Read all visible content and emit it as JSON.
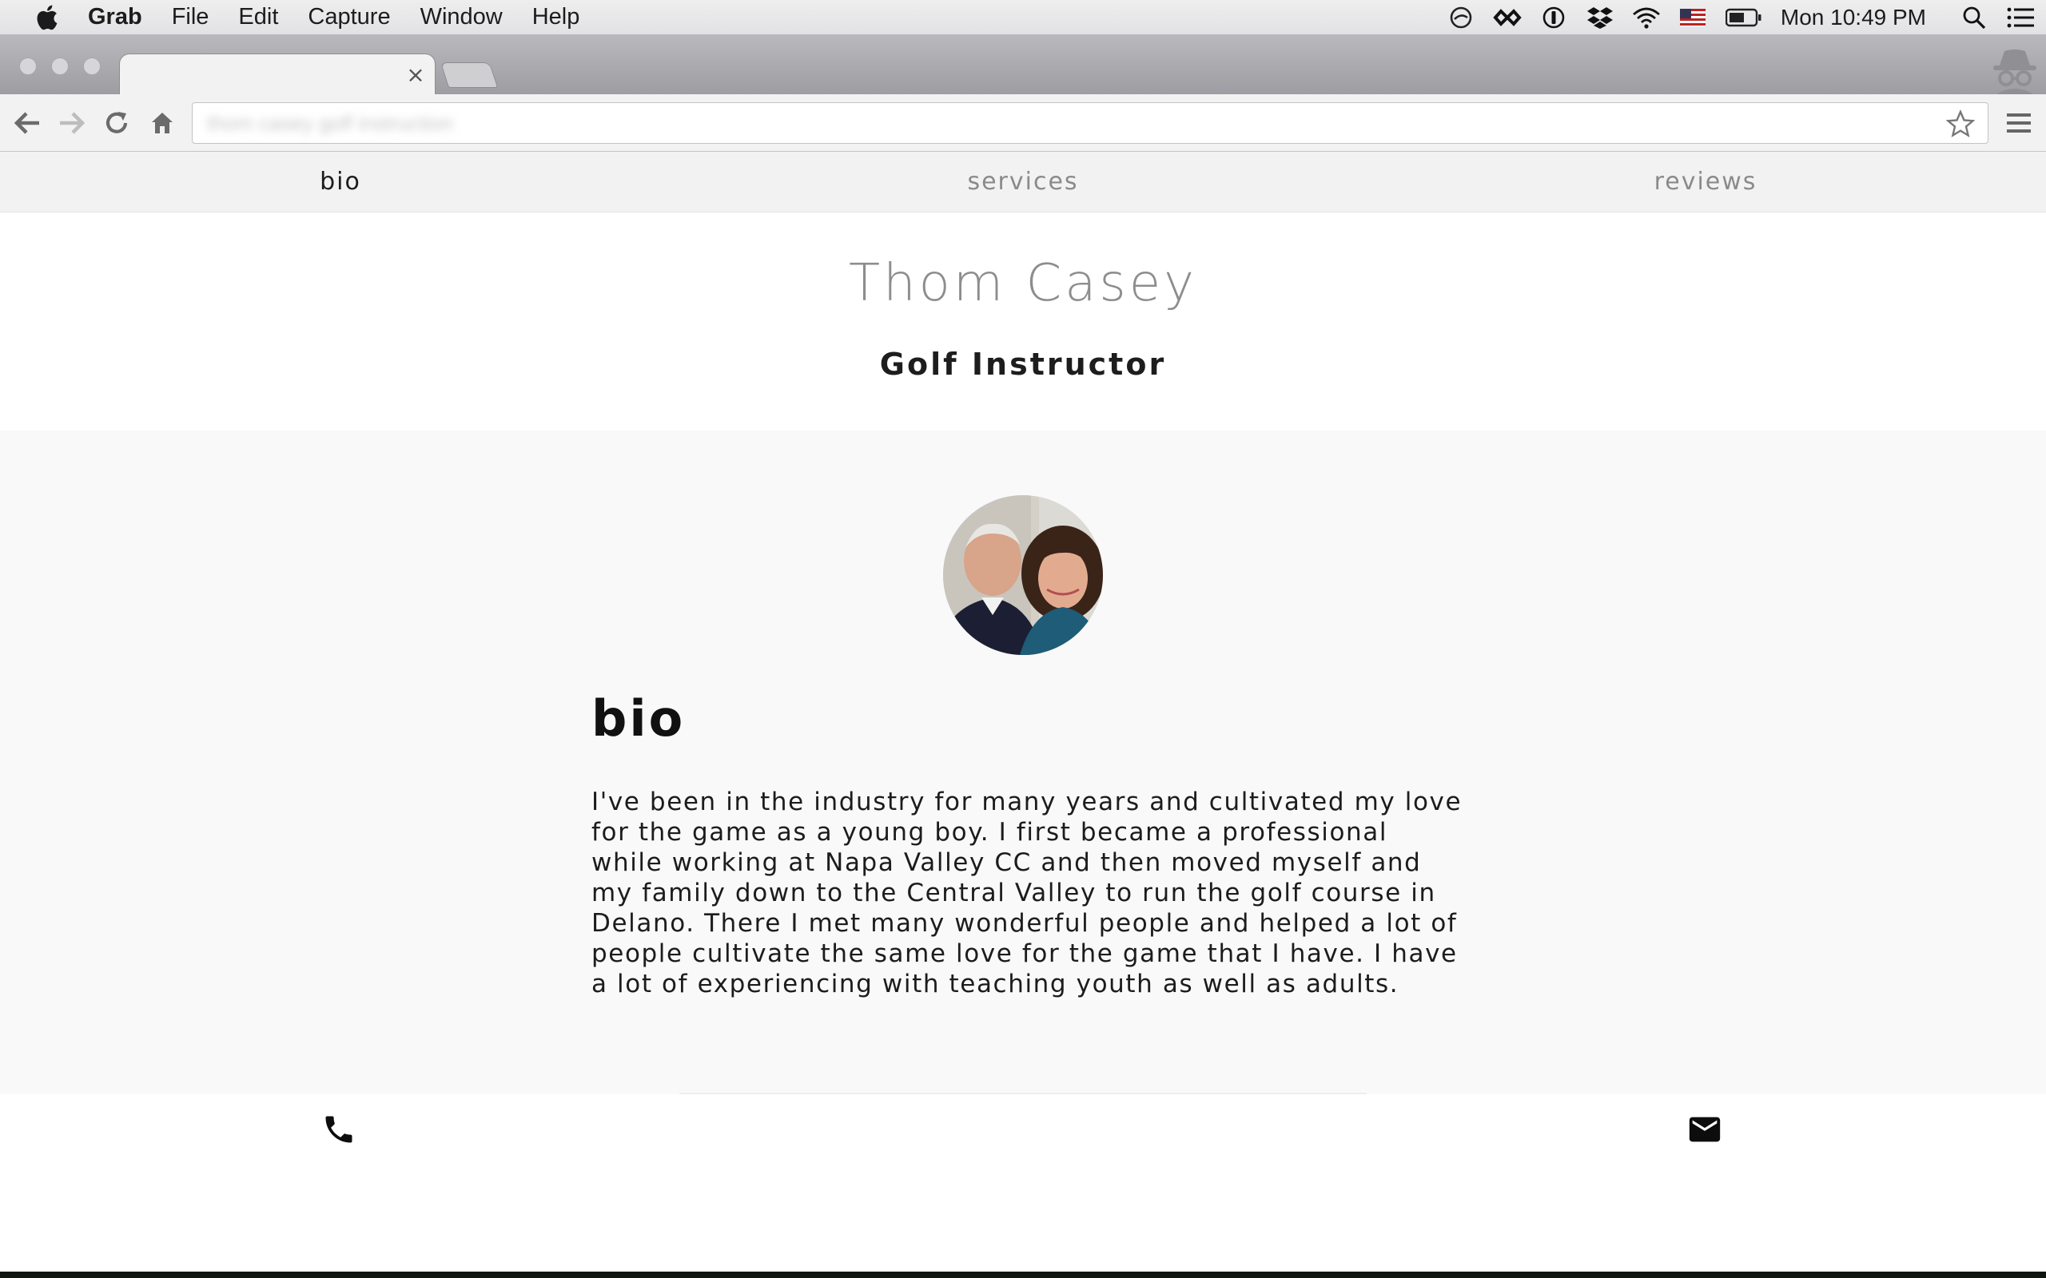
{
  "menubar": {
    "app_name": "Grab",
    "items": [
      "File",
      "Edit",
      "Capture",
      "Window",
      "Help"
    ],
    "clock": "Mon 10:49 PM",
    "status_icons": [
      "sync-icon",
      "infinity-icon",
      "1password-icon",
      "dropbox-icon",
      "wifi-icon",
      "flag-icon",
      "battery-icon",
      "spotlight-icon",
      "notification-center-icon"
    ]
  },
  "browser": {
    "url_placeholder": "thom casey golf instruction"
  },
  "nav": {
    "bio": "bio",
    "services": "services",
    "reviews": "reviews"
  },
  "header": {
    "name": "Thom Casey",
    "title": "Golf Instructor"
  },
  "bio": {
    "heading": "bio",
    "text": "I've been in the industry for many years and cultivated my love for the game as a young boy. I first became a professional while working at Napa Valley CC and then moved myself and my family down to the Central Valley to run the golf course in Delano. There I met many wonderful people and helped a lot of people cultivate the same love for the game that I have. I have a lot of experiencing with teaching youth as well as adults."
  },
  "colors": {
    "nav_bg": "#f2f2f2",
    "section_bg": "#f9f9f9",
    "name_gray": "#8d8d8d"
  }
}
